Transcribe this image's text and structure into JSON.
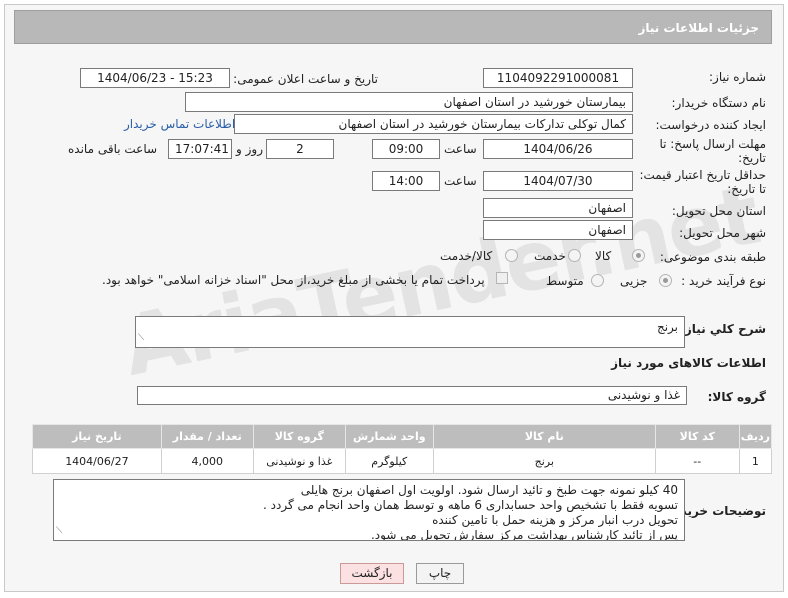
{
  "header": {
    "title": "جزئیات اطلاعات نیاز"
  },
  "watermark": "AriaTender.net",
  "fields": {
    "need_number": {
      "label": "شماره نیاز:",
      "value": "1104092291000081"
    },
    "announce": {
      "label": "تاریخ و ساعت اعلان عمومی:",
      "value": "1404/06/23 - 15:23"
    },
    "buyer_org": {
      "label": "نام دستگاه خریدار:",
      "value": "بیمارستان خورشید در استان اصفهان"
    },
    "creator": {
      "label": "ایجاد کننده درخواست:",
      "value": "کمال توکلی تدارکات بیمارستان خورشید در استان اصفهان",
      "link": "اطلاعات تماس خریدار"
    },
    "reply_deadline": {
      "label_line1": "مهلت ارسال پاسخ: تا",
      "label_line2": "تاریخ:",
      "date": "1404/06/26",
      "time_label": "ساعت",
      "time": "09:00",
      "days": "2",
      "days_label": "روز و",
      "remaining": "17:07:41",
      "remaining_label": "ساعت باقی مانده"
    },
    "price_validity": {
      "label_line1": "حداقل تاریخ اعتبار قیمت:",
      "label_line2": "تا تاریخ:",
      "date": "1404/07/30",
      "time_label": "ساعت",
      "time": "14:00"
    },
    "province": {
      "label": "استان محل تحویل:",
      "value": "اصفهان"
    },
    "city": {
      "label": "شهر محل تحویل:",
      "value": "اصفهان"
    },
    "category": {
      "label": "طبقه بندی موضوعی:",
      "options": [
        "کالا",
        "خدمت",
        "کالا/خدمت"
      ],
      "selected": "کالا"
    },
    "process": {
      "label": "نوع فرآیند خرید :",
      "options": [
        "جزیی",
        "متوسط"
      ],
      "selected": "جزیی",
      "note": "پرداخت تمام یا بخشی از مبلغ خرید،از محل \"اسناد خزانه اسلامی\" خواهد بود."
    }
  },
  "description": {
    "label": "شرح کلي نياز:",
    "value": "برنج"
  },
  "goods_section": {
    "title": "اطلاعات کالاهای مورد نیاز",
    "group_label": "گروه کالا:",
    "group_value": "غذا و نوشیدنی"
  },
  "table": {
    "headers": [
      "ردیف",
      "کد کالا",
      "نام کالا",
      "واحد شمارش",
      "گروه کالا",
      "تعداد / مقدار",
      "تاریخ نیاز"
    ],
    "rows": [
      [
        "1",
        "--",
        "برنج",
        "کیلوگرم",
        "غذا و نوشیدنی",
        "4,000",
        "1404/06/27"
      ]
    ]
  },
  "buyer_notes": {
    "label": "توضیحات خریدار:",
    "lines": [
      "40 کیلو نمونه جهت طبخ و تائید ارسال شود. اولویت اول اصفهان برنج هایلی",
      "تسویه فقط با تشخیص واحد حسابداری 6 ماهه و توسط همان واحد انجام می گردد .",
      "تحویل درب انبار مرکز و هزینه حمل با تامین کننده",
      "پس از تائید کارشناس بهداشت مرکز سفارش تحویل می شود."
    ]
  },
  "buttons": {
    "print": "چاپ",
    "back": "بازگشت"
  }
}
